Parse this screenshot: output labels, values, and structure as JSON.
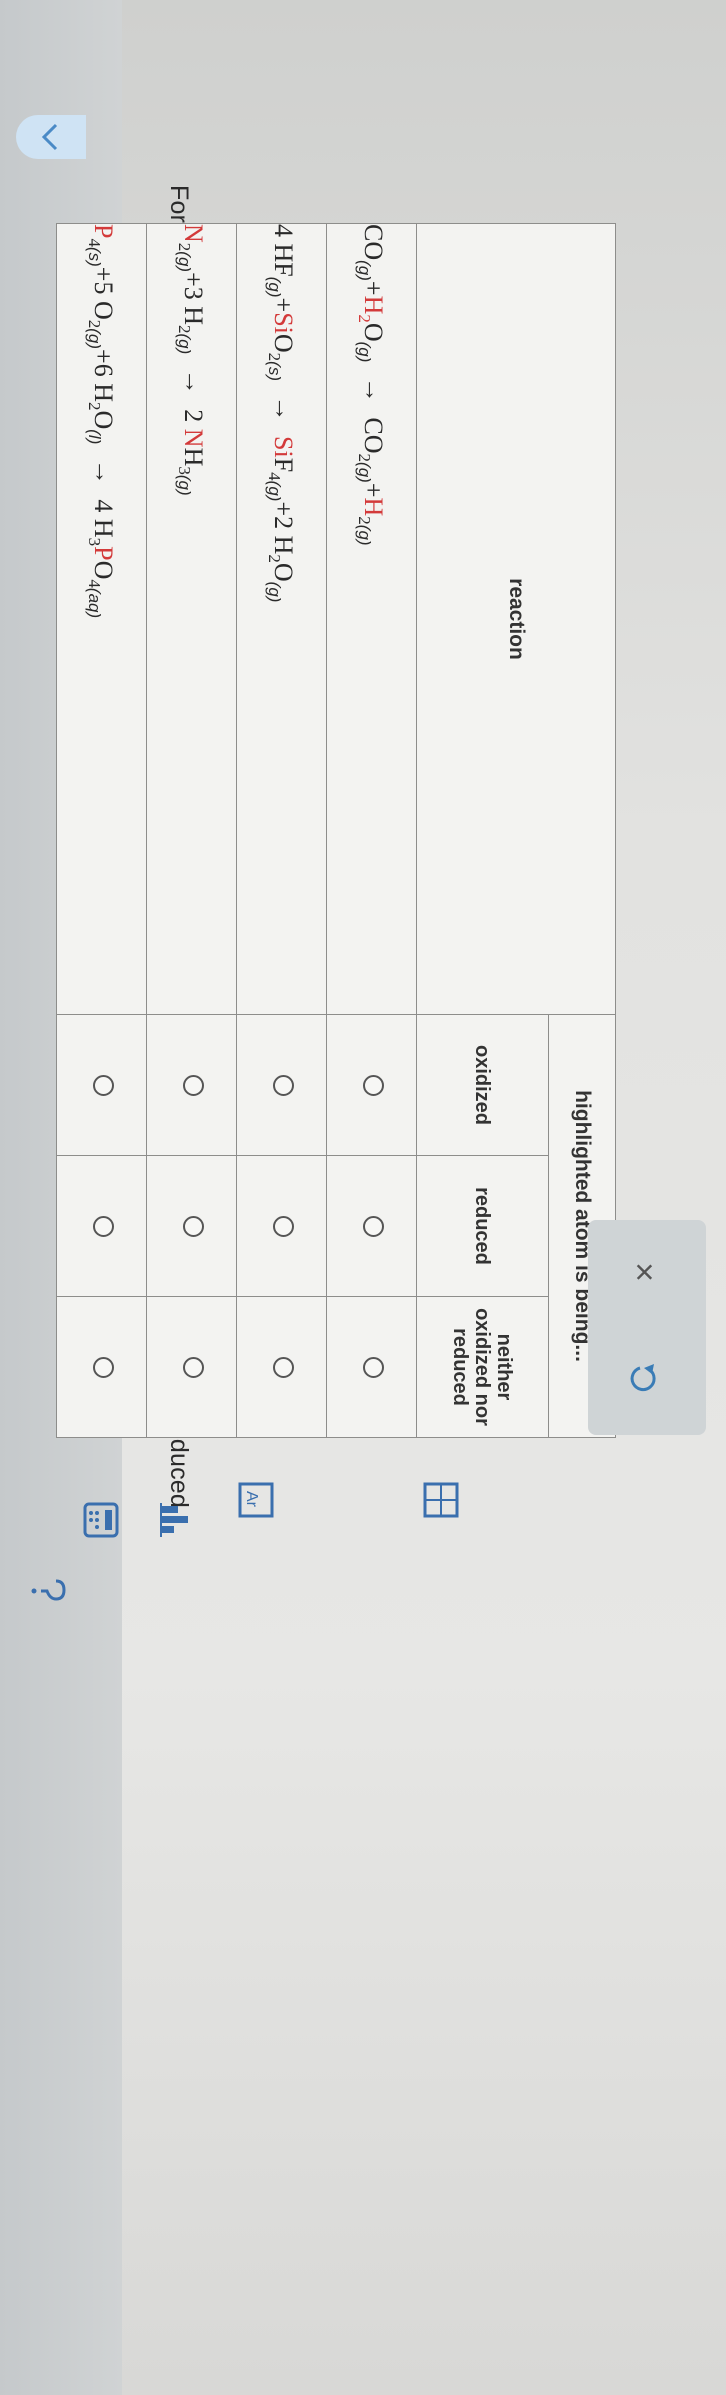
{
  "prompt": "For each chemical reaction listed in the table below, decide whether the highlighted atom is being oxidized or reduced.",
  "table": {
    "reaction_header": "reaction",
    "group_header": "highlighted atom is being...",
    "col_oxidized": "oxidized",
    "col_reduced": "reduced",
    "col_neither_1": "neither",
    "col_neither_2": "oxidized nor",
    "col_neither_3": "reduced"
  },
  "reactions": [
    {
      "parts": [
        "CO",
        "(g)",
        "+",
        "H",
        "2",
        "O",
        "(g)",
        "→",
        "CO",
        "2",
        "(g)",
        "+",
        "H",
        "2",
        "(g)"
      ]
    }
  ],
  "eq": {
    "r1_a": "CO",
    "r1_a_s": "(g)",
    "r1_b_h": "H",
    "r1_b_2": "2",
    "r1_b_o": "O",
    "r1_b_s": "(g)",
    "r1_c": "CO",
    "r1_c_2": "2",
    "r1_c_s": "(g)",
    "r1_d": "H",
    "r1_d_2": "2",
    "r1_d_s": "(g)",
    "r2_coef": "4",
    "r2_a": "HF",
    "r2_a_s": "(g)",
    "r2_b_si": "Si",
    "r2_b_o": "O",
    "r2_b_2": "2",
    "r2_b_s": "(s)",
    "r2_c_si": "Si",
    "r2_c_f": "F",
    "r2_c_4": "4",
    "r2_c_s": "(g)",
    "r2_d_coef": "2",
    "r2_d_h": "H",
    "r2_d_2": "2",
    "r2_d_o": "O",
    "r2_d_s": "(g)",
    "r3_a": "N",
    "r3_a_2": "2",
    "r3_a_s": "(g)",
    "r3_b_coef": "3",
    "r3_b": "H",
    "r3_b_2": "2",
    "r3_b_s": "(g)",
    "r3_c_coef": "2",
    "r3_c_n": "N",
    "r3_c_h": "H",
    "r3_c_3": "3",
    "r3_c_s": "(g)",
    "r4_a": "P",
    "r4_a_4": "4",
    "r4_a_s": "(s)",
    "r4_b_coef": "5",
    "r4_b": "O",
    "r4_b_2": "2",
    "r4_b_s": "(g)",
    "r4_c_coef": "6",
    "r4_c_h": "H",
    "r4_c_2": "2",
    "r4_c_o": "O",
    "r4_c_s": "(l)",
    "r4_d_coef": "4",
    "r4_d_h": "H",
    "r4_d_3": "3",
    "r4_d_p": "P",
    "r4_d_o": "O",
    "r4_d_4": "4",
    "r4_d_s": "(aq)",
    "plus": "+",
    "arrow": "→"
  },
  "actions": {
    "close": "×"
  },
  "colors": {
    "highlight": "#d33a3a",
    "accent": "#3a7cb6"
  },
  "icons": [
    "chevron-down-icon",
    "close-icon",
    "undo-icon",
    "help-icon",
    "calculator-icon",
    "bar-chart-icon",
    "periodic-table-icon",
    "grid-icon"
  ]
}
